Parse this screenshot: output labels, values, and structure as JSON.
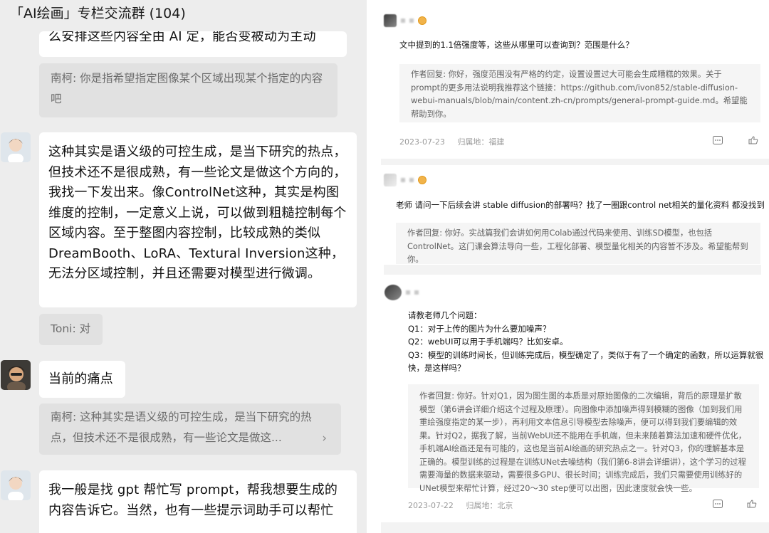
{
  "chat": {
    "title": "「AI绘画」专栏交流群 (104)",
    "cut_line": "么安排这些内容全由 AI 定，能否变被动为主动",
    "messages": [
      {
        "type": "quote",
        "text": "南柯: 你是指希望指定图像某个区域出现某个指定的内容吧"
      },
      {
        "type": "bubble",
        "text": "这种其实是语义级的可控生成，是当下研究的热点，但技术还不是很成熟，有一些论文是做这个方向的，我找一下发出来。像ControlNet这种，其实是构图维度的控制，一定意义上说，可以做到粗糙控制每个区域内容。至于整图内容控制，比较成熟的类似DreamBooth、LoRA、Textural Inversion这种，无法分区域控制，并且还需要对模型进行微调。"
      },
      {
        "type": "quote",
        "text": "Toni: 对"
      },
      {
        "type": "bubble",
        "text": "当前的痛点"
      },
      {
        "type": "quote",
        "text": "南柯: 这种其实是语义级的可控生成，是当下研究的热点，但技术还不是很成熟，有一些论文是做这..."
      },
      {
        "type": "bubble",
        "text": "我一般是找 gpt 帮忙写 prompt，帮我想要生成的内容告诉它。当然，也有一些提示词助手可以帮忙"
      }
    ]
  },
  "comments": [
    {
      "question": "文中提到的1.1倍强度等，这些从哪里可以查询到？范围是什么？",
      "reply": "作者回复: 你好，强度范围没有严格的约定，设置设置过大可能会生成糟糕的效果。关于prompt的更多用法说明我推荐这个链接：https://github.com/ivon852/stable-diffusion-webui-manuals/blob/main/content.zh-cn/prompts/general-prompt-guide.md。希望能帮助到你。",
      "date": "2023-07-23",
      "location": "归属地：福建"
    },
    {
      "question": "老师 请问一下后续会讲 stable diffusion的部署吗？找了一圈跟control net相关的量化资料 都没找到",
      "reply": "作者回复: 你好。实战篇我们会讲如何用Colab通过代码来使用、训练SD模型，也包括ControlNet。这门课会算法导向一些，工程化部署、模型量化相关的内容暂不涉及。希望能帮到你。"
    },
    {
      "question_lines": [
        "请教老师几个问题：",
        "Q1：对于上传的图片为什么要加噪声？",
        "Q2：webUI可以用于手机端吗？比如安卓。",
        "Q3：模型的训练时间长，但训练完成后，模型确定了，类似于有了一个确定的函数，所以运算就很快，是这样吗？"
      ],
      "reply": "作者回复: 你好。针对Q1，因为图生图的本质是对原始图像的二次编辑，背后的原理是扩散模型（第6讲会详细介绍这个过程及原理）。向图像中添加噪声得到模糊的图像（加到我们用重绘强度指定的某一步），再利用文本信息引导模型去除噪声，便可以得到我们要编辑的效果。针对Q2，据我了解，当前WebUI还不能用在手机端，但未来随着算法加速和硬件优化，手机端AI绘画还是有可能的，这也是当前AI绘画的研究热点之一。针对Q3，你的理解基本是正确的。模型训练的过程是在训练UNet去噪结构（我们第6-8讲会详细讲），这个学习的过程需要海量的数据来驱动，需要很多GPU、很长时间；训练完成后，我们只需要使用训练好的UNet模型来帮忙计算，经过20～30 step便可以出图，因此速度就会快一些。",
      "date": "2023-07-22",
      "location": "归属地：北京"
    }
  ],
  "colors": {
    "chat_bg": "#ededed",
    "bubble": "#ffffff",
    "quote": "#e1e1e1",
    "reply_bg": "#f5f5f5",
    "meta": "#9a9a9a"
  },
  "icons": [
    "more-icon",
    "like-icon"
  ]
}
